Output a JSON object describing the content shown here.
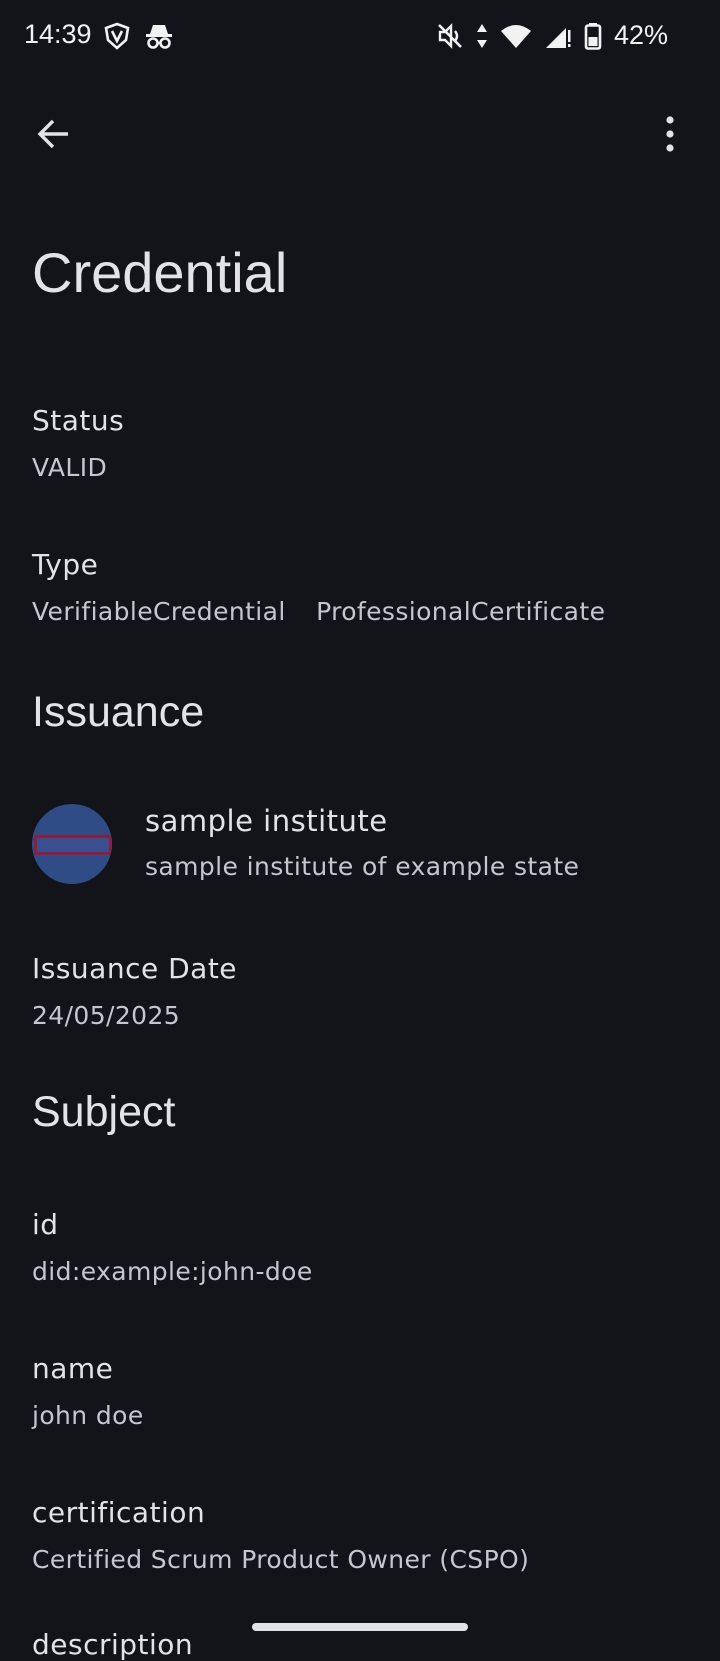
{
  "status_bar": {
    "time": "14:39",
    "battery_percent": "42%",
    "left_icons": [
      "vpn-shield-icon",
      "incognito-icon"
    ],
    "right_icons": [
      "mute-icon",
      "data-arrows-icon",
      "wifi-icon",
      "cell-signal-icon",
      "battery-icon"
    ]
  },
  "app_bar": {
    "back_icon": "arrow-left-icon",
    "menu_icon": "more-vert-icon"
  },
  "page": {
    "title": "Credential"
  },
  "status": {
    "label": "Status",
    "value": "VALID"
  },
  "type": {
    "label": "Type",
    "values": [
      "VerifiableCredential",
      "ProfessionalCertificate"
    ]
  },
  "issuance": {
    "section_title": "Issuance",
    "issuer": {
      "name": "sample institute",
      "description": "sample institute of example state"
    },
    "date_label": "Issuance Date",
    "date_value": "24/05/2025"
  },
  "subject": {
    "section_title": "Subject",
    "fields": [
      {
        "label": "id",
        "value": "did:example:john-doe"
      },
      {
        "label": "name",
        "value": "john doe"
      },
      {
        "label": "certification",
        "value": "Certified Scrum Product Owner (CSPO)"
      },
      {
        "label": "description",
        "value": ""
      }
    ]
  },
  "colors": {
    "background": "#131419",
    "primary_text": "#e3e2e9",
    "secondary_text": "#c6c5d0",
    "avatar_bg": "#2f4c86"
  }
}
